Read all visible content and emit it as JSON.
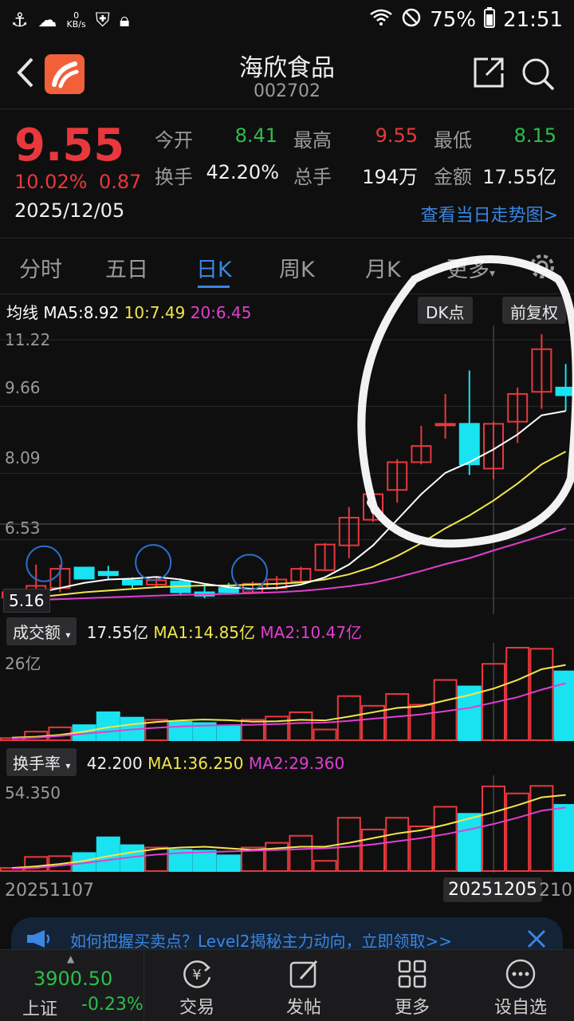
{
  "status_bar": {
    "kbs_value": "0",
    "kbs_unit": "KB/s",
    "battery": "75%",
    "time": "21:51"
  },
  "header": {
    "title": "海欣食品",
    "code": "002702"
  },
  "quote": {
    "price": "9.55",
    "change_pct": "10.02%",
    "change_amt": "0.87",
    "date": "2025/12/05",
    "open_label": "今开",
    "open": "8.41",
    "high_label": "最高",
    "high": "9.55",
    "low_label": "最低",
    "low": "8.15",
    "turnover_label": "换手",
    "turnover": "42.20%",
    "volume_label": "总手",
    "volume": "194万",
    "amount_label": "金额",
    "amount": "17.55亿",
    "trend_link": "查看当日走势图>"
  },
  "tabs": [
    "分时",
    "五日",
    "日K",
    "周K",
    "月K",
    "更多"
  ],
  "active_tab": "日K",
  "ma_legend": {
    "prefix": "均线",
    "ma5": "MA5:8.92",
    "ma10": "10:7.49",
    "ma20": "20:6.45"
  },
  "buttons": {
    "dk": "DK点",
    "adjust": "前复权"
  },
  "price_axis": [
    "11.22",
    "9.66",
    "8.09",
    "6.53",
    "5.16"
  ],
  "volume_panel": {
    "selector": "成交额",
    "value": "17.55亿",
    "ma1": "MA1:14.85亿",
    "ma2": "MA2:10.47亿",
    "axis_top": "26亿"
  },
  "turnover_panel": {
    "selector": "换手率",
    "value": "42.200",
    "ma1": "MA1:36.250",
    "ma2": "MA2:29.360",
    "axis_top": "54.350"
  },
  "dates": {
    "start": "20251107",
    "selected": "20251205",
    "end_partial": "210"
  },
  "banner": {
    "text": "如何把握买卖点？Level2揭秘主力动向，立即领取>>"
  },
  "bottom_bar": {
    "index_value": "3900.50",
    "index_name": "上证",
    "index_change": "-0.23%",
    "nav": [
      "交易",
      "发帖",
      "更多",
      "设自选"
    ]
  },
  "colors": {
    "up": "#e8383d",
    "down": "#2bbf4a",
    "bear_fill": "#19e3f0",
    "accent": "#3a86e0",
    "ma_white": "#ffffff",
    "ma_yellow": "#f2e64a",
    "ma_magenta": "#e13fd0"
  },
  "chart_data": {
    "type": "candlestick",
    "y_range": [
      5.16,
      11.22
    ],
    "candles": [
      {
        "o": 5.18,
        "h": 5.32,
        "l": 5.16,
        "c": 5.3,
        "dir": "up"
      },
      {
        "o": 5.32,
        "h": 5.95,
        "l": 5.2,
        "c": 5.45,
        "dir": "up"
      },
      {
        "o": 5.4,
        "h": 5.95,
        "l": 5.3,
        "c": 5.85,
        "dir": "up"
      },
      {
        "o": 5.88,
        "h": 5.9,
        "l": 5.62,
        "c": 5.62,
        "dir": "down"
      },
      {
        "o": 5.78,
        "h": 5.92,
        "l": 5.58,
        "c": 5.7,
        "dir": "down"
      },
      {
        "o": 5.58,
        "h": 5.65,
        "l": 5.4,
        "c": 5.48,
        "dir": "down"
      },
      {
        "o": 5.48,
        "h": 5.65,
        "l": 5.4,
        "c": 5.58,
        "dir": "up"
      },
      {
        "o": 5.55,
        "h": 5.62,
        "l": 5.22,
        "c": 5.3,
        "dir": "down"
      },
      {
        "o": 5.3,
        "h": 5.48,
        "l": 5.16,
        "c": 5.22,
        "dir": "down"
      },
      {
        "o": 5.4,
        "h": 5.52,
        "l": 5.3,
        "c": 5.3,
        "dir": "down"
      },
      {
        "o": 5.3,
        "h": 5.55,
        "l": 5.28,
        "c": 5.5,
        "dir": "up"
      },
      {
        "o": 5.4,
        "h": 5.68,
        "l": 5.35,
        "c": 5.6,
        "dir": "up"
      },
      {
        "o": 5.55,
        "h": 5.9,
        "l": 5.52,
        "c": 5.85,
        "dir": "up"
      },
      {
        "o": 5.82,
        "h": 6.45,
        "l": 5.8,
        "c": 6.42,
        "dir": "up"
      },
      {
        "o": 6.4,
        "h": 7.3,
        "l": 6.1,
        "c": 7.05,
        "dir": "up"
      },
      {
        "o": 7.0,
        "h": 7.7,
        "l": 6.95,
        "c": 7.6,
        "dir": "up"
      },
      {
        "o": 7.7,
        "h": 8.42,
        "l": 7.4,
        "c": 8.35,
        "dir": "up"
      },
      {
        "o": 8.35,
        "h": 9.2,
        "l": 8.3,
        "c": 8.73,
        "dir": "up"
      },
      {
        "o": 9.25,
        "h": 9.95,
        "l": 8.9,
        "c": 9.25,
        "dir": "up"
      },
      {
        "o": 9.25,
        "h": 10.5,
        "l": 8.05,
        "c": 8.3,
        "dir": "down"
      },
      {
        "o": 8.2,
        "h": 9.3,
        "l": 7.95,
        "c": 9.25,
        "dir": "up"
      },
      {
        "o": 9.3,
        "h": 10.1,
        "l": 8.8,
        "c": 9.95,
        "dir": "up"
      },
      {
        "o": 10.0,
        "h": 11.35,
        "l": 9.6,
        "c": 11.0,
        "dir": "up"
      },
      {
        "o": 10.1,
        "h": 10.65,
        "l": 9.55,
        "c": 9.92,
        "dir": "down"
      }
    ],
    "ma5": [
      5.25,
      5.28,
      5.4,
      5.52,
      5.6,
      5.62,
      5.66,
      5.6,
      5.5,
      5.42,
      5.38,
      5.4,
      5.48,
      5.65,
      5.95,
      6.4,
      7.0,
      7.6,
      8.1,
      8.35,
      8.65,
      9.0,
      9.45,
      9.55
    ],
    "ma10": [
      5.16,
      5.18,
      5.24,
      5.3,
      5.34,
      5.38,
      5.42,
      5.44,
      5.46,
      5.46,
      5.48,
      5.5,
      5.53,
      5.6,
      5.72,
      5.9,
      6.15,
      6.45,
      6.8,
      7.1,
      7.45,
      7.85,
      8.3,
      8.6
    ],
    "ma20": [
      5.1,
      5.12,
      5.14,
      5.16,
      5.18,
      5.2,
      5.22,
      5.24,
      5.25,
      5.26,
      5.28,
      5.3,
      5.33,
      5.38,
      5.44,
      5.52,
      5.65,
      5.8,
      5.96,
      6.1,
      6.28,
      6.45,
      6.62,
      6.8
    ],
    "volume": [
      1.0,
      4.0,
      6.0,
      7.0,
      13.0,
      10.5,
      9.5,
      8.5,
      8.0,
      6.5,
      9.5,
      11.0,
      13.0,
      5.0,
      20.5,
      16.0,
      21.5,
      16.5,
      28.0,
      25.0,
      35.5,
      43.0,
      42.5,
      32.0
    ],
    "turnover": [
      2.0,
      9.0,
      9.5,
      11.5,
      21.5,
      16.5,
      15.0,
      13.5,
      13.0,
      10.0,
      15.0,
      18.0,
      22.5,
      6.5,
      34.0,
      26.5,
      34.0,
      28.5,
      41.0,
      36.5,
      54.0,
      49.5,
      54.3,
      42.2
    ],
    "vol_ma1": [
      1.2,
      1.6,
      2.5,
      4.0,
      6.0,
      7.4,
      8.5,
      9.2,
      9.6,
      9.3,
      8.6,
      8.8,
      9.5,
      9.2,
      11.0,
      13.0,
      15.0,
      15.8,
      18.5,
      21.0,
      24.0,
      28.0,
      33.0,
      35.0
    ],
    "vol_ma2": [
      0.8,
      1.2,
      2.0,
      3.0,
      4.0,
      5.0,
      5.8,
      6.4,
      6.8,
      7.0,
      7.2,
      7.5,
      8.0,
      8.2,
      9.0,
      10.0,
      11.0,
      12.0,
      13.5,
      15.0,
      17.5,
      20.0,
      23.5,
      26.5
    ],
    "to_ma1": [
      2.0,
      3.0,
      4.5,
      6.5,
      9.5,
      12.0,
      14.0,
      15.0,
      15.5,
      14.5,
      13.5,
      14.5,
      15.5,
      15.5,
      18.0,
      21.0,
      24.0,
      26.0,
      29.5,
      33.5,
      37.5,
      42.0,
      47.0,
      48.5
    ],
    "to_ma2": [
      1.5,
      2.0,
      3.5,
      5.0,
      7.0,
      9.0,
      10.5,
      11.5,
      12.0,
      12.5,
      13.0,
      13.5,
      14.0,
      14.5,
      15.5,
      17.0,
      19.0,
      21.0,
      23.5,
      26.5,
      30.0,
      34.0,
      38.5,
      40.5
    ]
  }
}
